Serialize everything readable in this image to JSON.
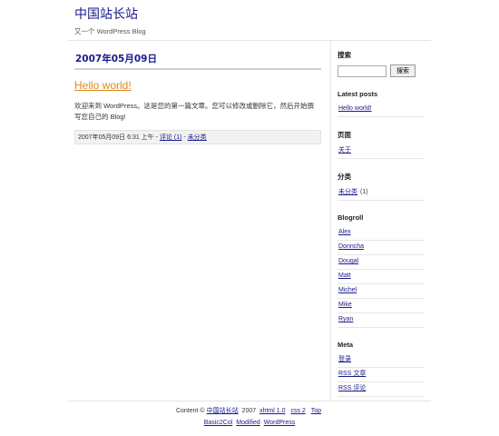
{
  "header": {
    "site_title": "中国站长站",
    "tagline": "又一个 WordPress Blog"
  },
  "post": {
    "date_heading": "2007年05月09日",
    "title": "Hello world!",
    "body": "欢迎来到 WordPress。这是您的第一篇文章。您可以修改或删除它，然后开始撰写您自己的 Blog!",
    "meta": {
      "date": "2007年05月09日",
      "time": "6:31 上午",
      "separator": "-",
      "comments_label": "评论 (1)",
      "category_label": "未分类"
    }
  },
  "sidebar": {
    "search": {
      "title": "搜索",
      "input_value": "",
      "button_label": "搜索"
    },
    "latest_posts": {
      "title": "Latest posts",
      "items": [
        "Hello world!"
      ]
    },
    "pages": {
      "title": "页面",
      "items": [
        "关于"
      ]
    },
    "categories": {
      "title": "分类",
      "items": [
        {
          "label": "未分类",
          "count": "(1)"
        }
      ]
    },
    "blogroll": {
      "title": "Blogroll",
      "items": [
        "Alex",
        "Donncha",
        "Dougal",
        "Matt",
        "Michel",
        "Mike",
        "Ryan"
      ]
    },
    "meta": {
      "title": "Meta",
      "items": [
        "登录",
        "RSS 文章",
        "RSS 评论"
      ]
    }
  },
  "footer": {
    "content_prefix": "Content ©",
    "site_link": "中国站长站",
    "year": "2007",
    "xhtml_link": "xhtml 1.0",
    "css_link": "css 2",
    "top_link": "Top",
    "theme_link": "Basic2Col",
    "modified_link": "Modified",
    "wordpress_link": "WordPress"
  }
}
